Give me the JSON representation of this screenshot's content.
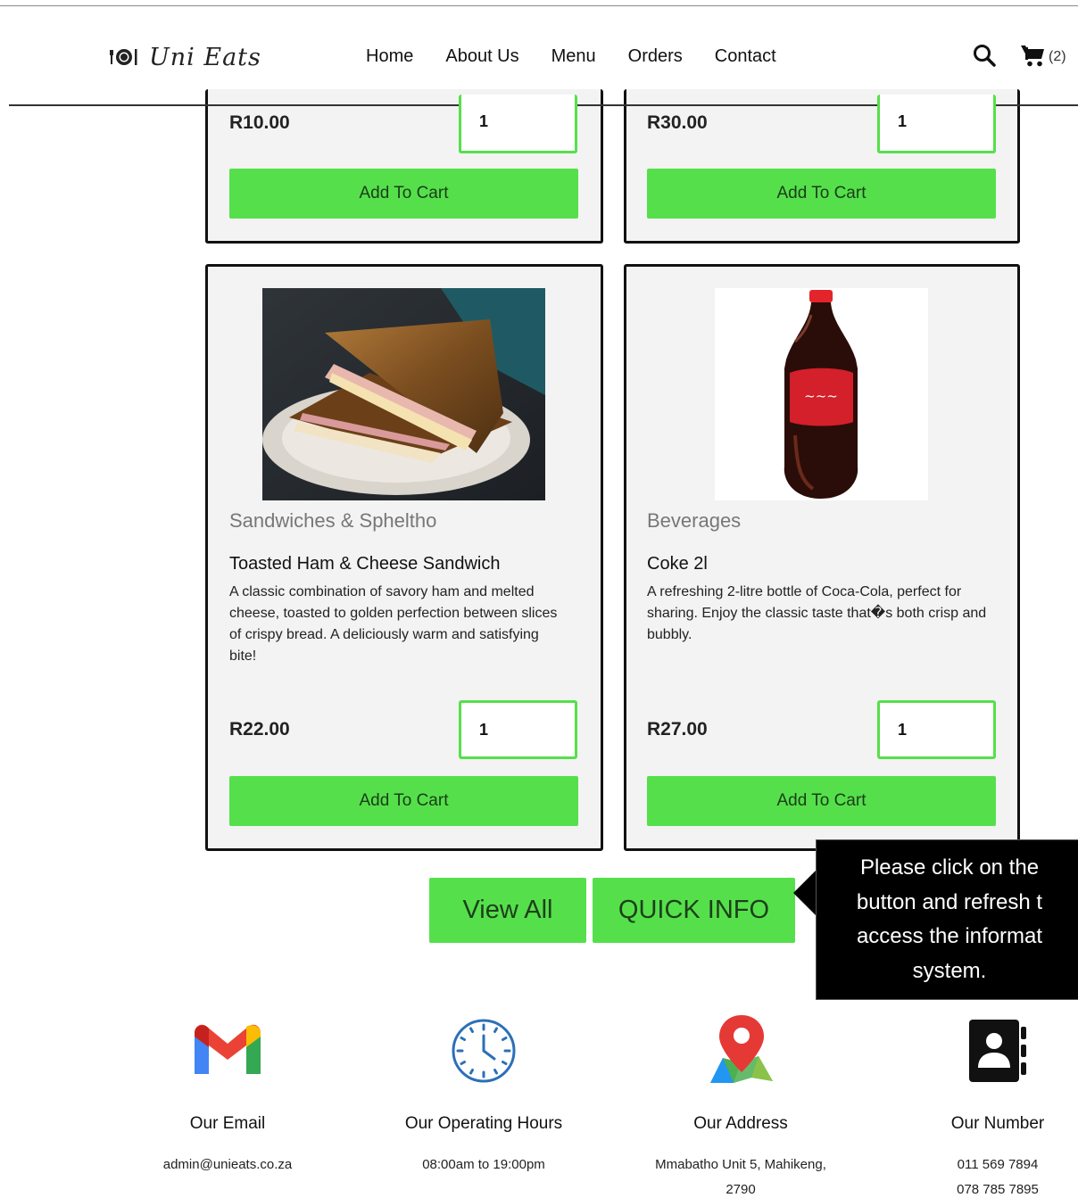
{
  "header": {
    "brand": "Uni Eats",
    "nav": [
      "Home",
      "About Us",
      "Menu",
      "Orders",
      "Contact"
    ],
    "cart_count": "(2)"
  },
  "top_cards": [
    {
      "price": "R10.00",
      "qty": "1",
      "button": "Add To Cart"
    },
    {
      "price": "R30.00",
      "qty": "1",
      "button": "Add To Cart"
    }
  ],
  "products": [
    {
      "category": "Sandwiches & Spheltho",
      "title": "Toasted Ham & Cheese Sandwich",
      "description": "A classic combination of savory ham and melted cheese, toasted to golden perfection between slices of crispy bread. A deliciously warm and satisfying bite!",
      "price": "R22.00",
      "qty": "1",
      "button": "Add To Cart"
    },
    {
      "category": "Beverages",
      "title": "Coke 2l",
      "description": "A refreshing 2-litre bottle of Coca-Cola, perfect for sharing. Enjoy the classic taste that�s both crisp and bubbly.",
      "price": "R27.00",
      "qty": "1",
      "button": "Add To Cart"
    }
  ],
  "actions": {
    "view_all": "View All",
    "quick_info": "QUICK INFO"
  },
  "tooltip": {
    "lines": [
      "Please click on the",
      "button and refresh t",
      "access the informat",
      "system."
    ]
  },
  "footer": [
    {
      "title": "Our Email",
      "lines": [
        "admin@unieats.co.za"
      ]
    },
    {
      "title": "Our Operating Hours",
      "lines": [
        "08:00am to 19:00pm"
      ]
    },
    {
      "title": "Our Address",
      "lines": [
        "Mmabatho Unit 5, Mahikeng,",
        "2790"
      ]
    },
    {
      "title": "Our Number",
      "lines": [
        "011 569 7894",
        "078 785 7895"
      ]
    }
  ],
  "colors": {
    "accent_green": "#55e04b",
    "card_bg": "#f3f3f3"
  },
  "icons": [
    "plate-icon",
    "search-icon",
    "cart-icon",
    "gmail-icon",
    "clock-icon",
    "map-pin-icon",
    "contact-book-icon"
  ]
}
